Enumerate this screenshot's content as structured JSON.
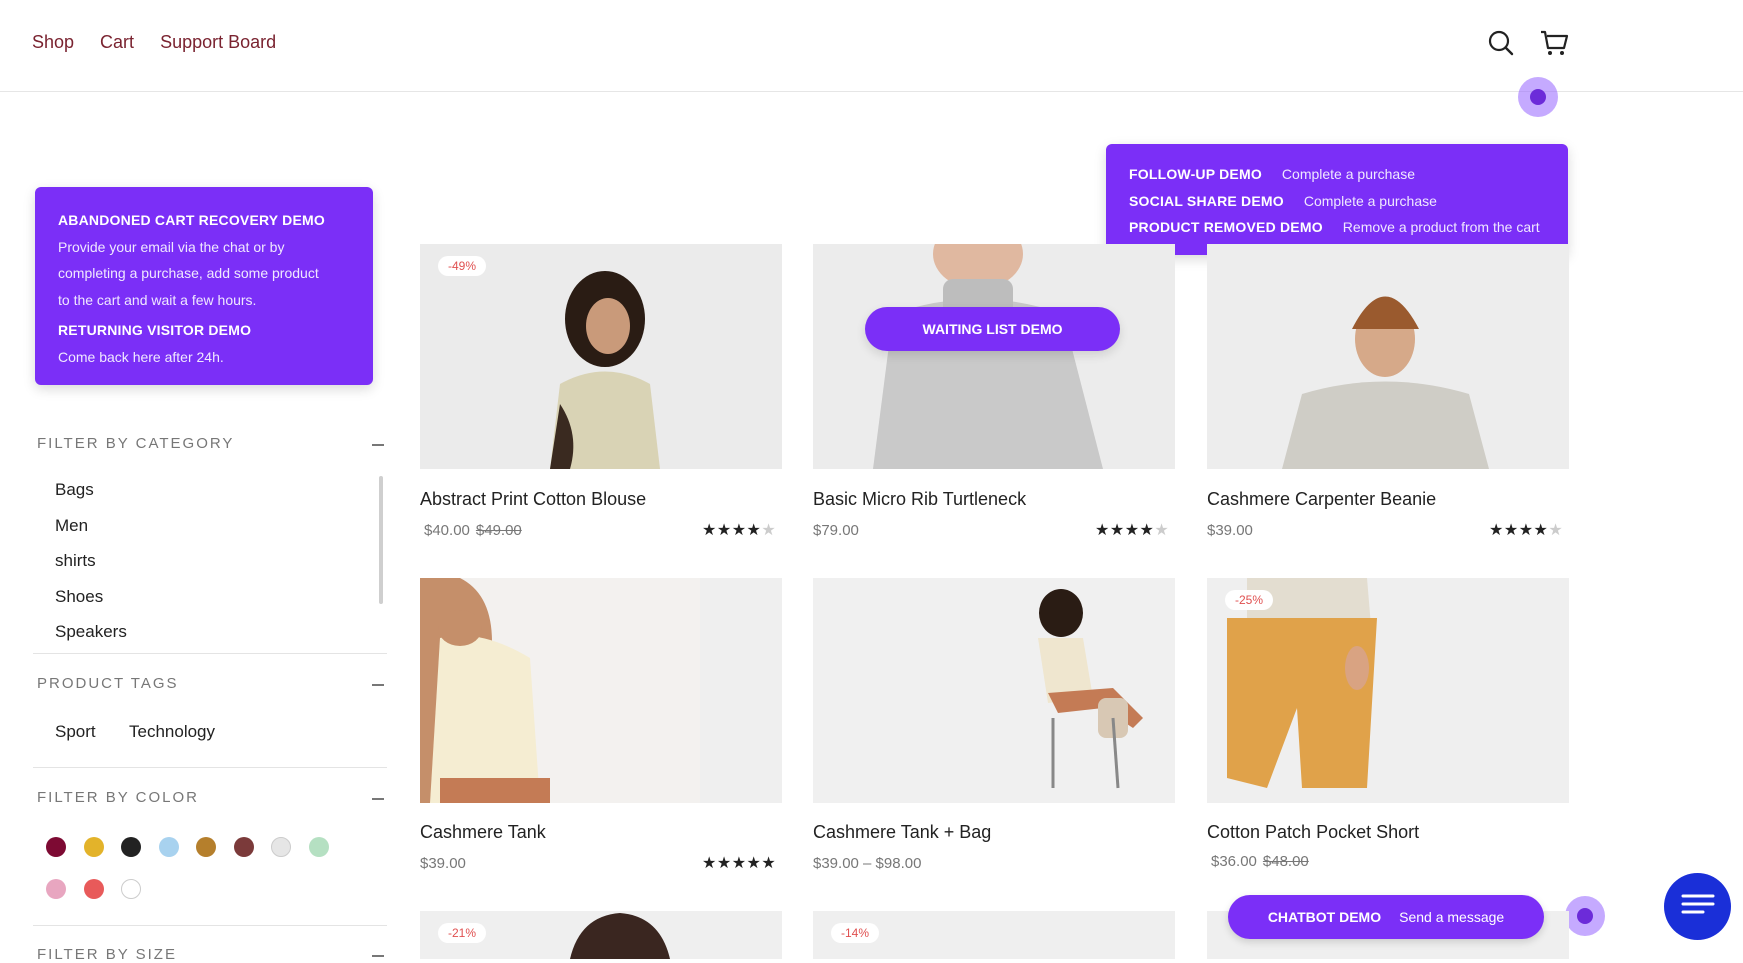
{
  "nav": {
    "shop": "Shop",
    "cart": "Cart",
    "support": "Support Board"
  },
  "left_demo": {
    "title1": "ABANDONED CART RECOVERY  DEMO",
    "desc1_line1": "Provide your email via the chat or by",
    "desc1_line2": "completing a purchase, add some product",
    "desc1_line3": "to the cart and wait a few hours.",
    "title2": "RETURNING VISITOR DEMO",
    "desc2": "Come back here after 24h."
  },
  "right_demo": {
    "rows": [
      {
        "title": "FOLLOW-UP DEMO",
        "desc": "Complete a purchase"
      },
      {
        "title": "SOCIAL SHARE DEMO",
        "desc": "Complete a purchase"
      },
      {
        "title": "PRODUCT REMOVED DEMO",
        "desc": "Remove a product from the cart"
      }
    ]
  },
  "filters": {
    "category_title": "FILTER BY CATEGORY",
    "categories": [
      "Bags",
      "Men",
      "shirts",
      "Shoes",
      "Speakers"
    ],
    "tags_title": "PRODUCT TAGS",
    "tags": [
      "Sport",
      "Technology"
    ],
    "color_title": "FILTER BY COLOR",
    "colors": [
      "#7d0a33",
      "#e3b32a",
      "#222222",
      "#a8d2ef",
      "#b57f2c",
      "#7b3a3a",
      "#e6e6e6",
      "#b5e0c2",
      "#e8a6c0",
      "#e85a5a",
      "#ffffff"
    ],
    "size_title": "FILTER BY SIZE"
  },
  "products": [
    {
      "name": "Abstract Print Cotton Blouse",
      "price": "$40.00",
      "old_price": "$49.00",
      "badge": "-49%",
      "rating": 4
    },
    {
      "name": "Basic Micro Rib Turtleneck",
      "price": "$79.00",
      "old_price": "",
      "badge": "",
      "rating": 4
    },
    {
      "name": "Cashmere Carpenter Beanie",
      "price": "$39.00",
      "old_price": "",
      "badge": "",
      "rating": 4
    },
    {
      "name": "Cashmere Tank",
      "price": "$39.00",
      "old_price": "",
      "badge": "",
      "rating": 5
    },
    {
      "name": "Cashmere Tank + Bag",
      "price": "$39.00 – $98.00",
      "old_price": "",
      "badge": "",
      "rating": 0
    },
    {
      "name": "Cotton Patch Pocket Short",
      "price": "$36.00",
      "old_price": "$48.00",
      "badge": "-25%",
      "rating": 0
    }
  ],
  "bottom_badges": [
    "-21%",
    "-14%"
  ],
  "waiting_list": "WAITING LIST DEMO",
  "chatbot": {
    "title": "CHATBOT DEMO",
    "cta": "Send a message"
  },
  "icons": {
    "search": "search-icon",
    "cart": "cart-icon",
    "chat": "chat-menu-icon"
  }
}
